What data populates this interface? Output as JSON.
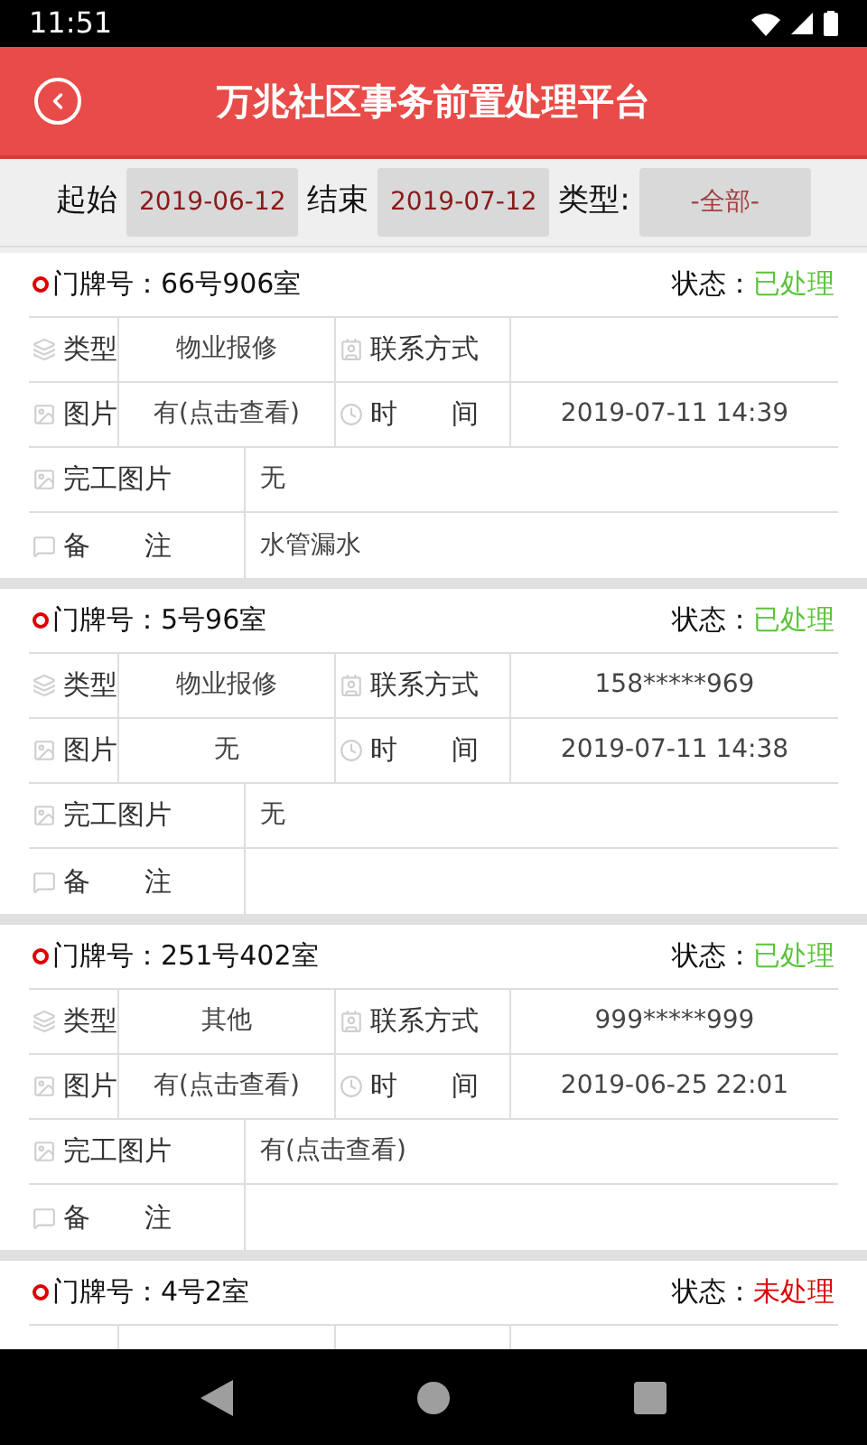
{
  "status_bar": {
    "time": "11:51"
  },
  "header": {
    "title": "万兆社区事务前置处理平台"
  },
  "filter": {
    "start_label": "起始",
    "start": "2019-06-12",
    "end_label": "结束",
    "end": "2019-07-12",
    "type_label": "类型:",
    "type": "-全部-"
  },
  "cards": [
    {
      "door": "门牌号：66号906室",
      "status_label": "状态：",
      "status": "已处理",
      "color": "#5cc33c",
      "labels": [
        "类型",
        "联系方式",
        "图片",
        "时　　间",
        "完工图片",
        "备　　注"
      ],
      "type": "物业报修",
      "picture": "有(点击查看)",
      "time": "2019-07-11 14:39",
      "done_picture": "无",
      "remark": "水管漏水"
    },
    {
      "door": "门牌号：5号96室",
      "status_label": "状态：",
      "status": "已处理",
      "color": "#5cc33c",
      "labels": [
        "类型",
        "联系方式",
        "图片",
        "时　　间",
        "完工图片",
        "备　　注"
      ],
      "type": "物业报修",
      "contact": "158*****969",
      "picture": "无",
      "time": "2019-07-11 14:38",
      "done_picture": "无"
    },
    {
      "door": "门牌号：251号402室",
      "status_label": "状态：",
      "status": "已处理",
      "color": "#5cc33c",
      "labels": [
        "类型",
        "联系方式",
        "图片",
        "时　　间",
        "完工图片",
        "备　　注"
      ],
      "type": "其他",
      "contact": "999*****999",
      "picture": "有(点击查看)",
      "time": "2019-06-25 22:01",
      "done_picture": "有(点击查看)"
    },
    {
      "door": "门牌号：4号2室",
      "status_label": "状态：",
      "status": "未处理",
      "color": "#dd0000"
    }
  ]
}
